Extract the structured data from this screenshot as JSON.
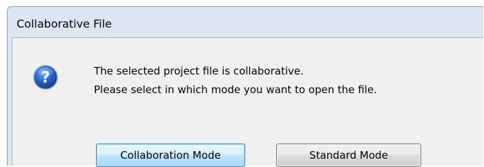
{
  "window": {
    "title": "Collaborative File"
  },
  "dialog": {
    "icon": "question-icon",
    "message_line1": "The selected project file is collaborative.",
    "message_line2": "Please select in which mode you want to open the file."
  },
  "buttons": {
    "collaboration_label": "Collaboration Mode",
    "standard_label": "Standard Mode"
  },
  "colors": {
    "icon_blue": "#1f56a8",
    "primary_button_border": "#3c7fb1",
    "window_frame": "#dbe6f1"
  }
}
